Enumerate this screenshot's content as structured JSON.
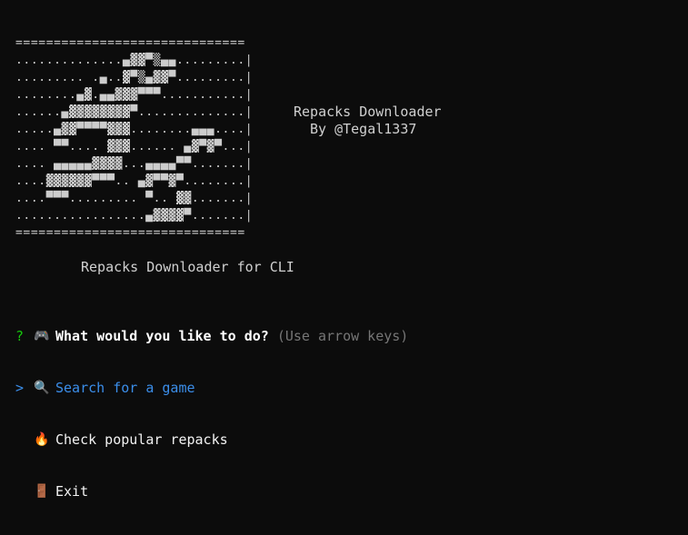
{
  "banner": {
    "art": "==============================\n..............▄▓▓▀▒▄▄.........|\n......... .▄..▓▀▒▄▓▓▀.........|\n........▄▓.▄▄▓▓▓▀▀▀...........|\n......▄▓▓▓▓▓▓▓▓▀..............|\n.....▄▓▓▀▀▀▀▓▓▓........▄▄▄....|\n.... ▀▀.... ▓▓▓...... ▄▓▀▓▀...|\n.... ▄▄▄▄▄▓▓▓▓...▄▄▄▄▀▀.......|\n....▓▓▓▓▓▓▀▀▀.. ▄▓▀▀▓▀........|\n....▀▀▀......... ▀.. ▓▓.......|\n.................▄▓▓▓▓▀.......|\n==============================",
    "title": "Repacks Downloader",
    "author": "By @Tegal1337"
  },
  "subtitle": "Repacks Downloader for CLI",
  "prompt": {
    "marker": "?",
    "icon": "🎮",
    "question": "What would you like to do?",
    "hint": "(Use arrow keys)"
  },
  "menu": {
    "pointer": ">",
    "options": [
      {
        "icon": "🔍",
        "label": "Search for a game",
        "selected": true
      },
      {
        "icon": "🔥",
        "label": "Check popular repacks",
        "selected": false
      },
      {
        "icon": "🚪",
        "label": "Exit",
        "selected": false
      }
    ]
  },
  "colors": {
    "background": "#0c0c0c",
    "prompt_marker": "#16c60c",
    "selection": "#3b8eea",
    "hint": "#767676"
  }
}
